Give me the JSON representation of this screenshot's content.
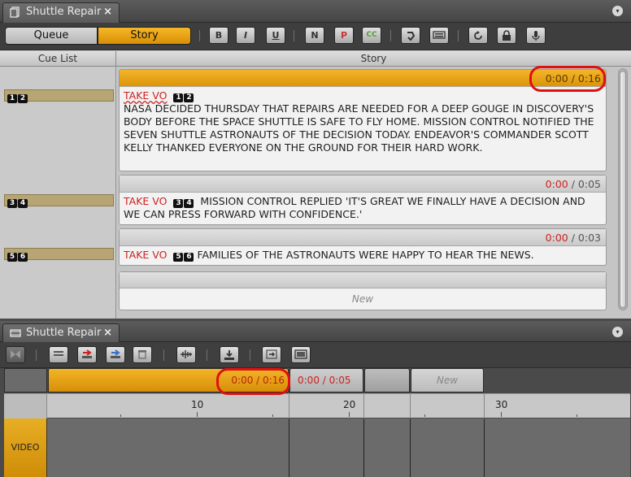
{
  "top_panel": {
    "tab_title": "Shuttle Repair",
    "close_glyph": "×",
    "menu_glyph": "▾",
    "modes": [
      "Queue",
      "Story"
    ],
    "active_mode": "Story",
    "format_buttons": [
      "B",
      "I",
      "U",
      "N",
      "P",
      "CC"
    ],
    "icons": [
      "spell-check-icon",
      "keyboard-icon",
      "refresh-icon",
      "lock-icon",
      "microphone-icon"
    ]
  },
  "columns": {
    "cue_list": "Cue List",
    "story": "Story"
  },
  "stories": [
    {
      "cue_numbers": [
        "1",
        "2"
      ],
      "time": "0:00 / 0:16",
      "take": "TAKE VO",
      "text": "NASA DECIDED THURSDAY THAT REPAIRS ARE NEEDED FOR A DEEP GOUGE IN DISCOVERY'S BODY BEFORE THE SPACE SHUTTLE IS SAFE TO FLY HOME. MISSION CONTROL NOTIFIED THE SEVEN SHUTTLE ASTRONAUTS OF THE DECISION TODAY. ENDEAVOR'S COMMANDER SCOTT KELLY THANKED EVERYONE ON THE GROUND FOR THEIR HARD WORK."
    },
    {
      "cue_numbers": [
        "3",
        "4"
      ],
      "time_elapsed": "0:00",
      "time_total": "/ 0:05",
      "take": "TAKE VO",
      "text": "MISSION CONTROL REPLIED 'IT'S GREAT WE FINALLY HAVE A DECISION AND WE CAN PRESS FORWARD WITH CONFIDENCE.'"
    },
    {
      "cue_numbers": [
        "5",
        "6"
      ],
      "time_elapsed": "0:00",
      "time_total": "/ 0:03",
      "take": "TAKE VO",
      "text": "FAMILIES OF THE ASTRONAUTS WERE HAPPY TO HEAR THE NEWS."
    }
  ],
  "new_story_label": "New",
  "bottom_panel": {
    "tab_title": "Shuttle Repair",
    "timeline_segments": [
      {
        "time": "0:00 / 0:16"
      },
      {
        "time": "0:00 / 0:05"
      },
      {
        "time": ""
      },
      {
        "time": "New"
      }
    ],
    "ruler_labels": [
      "10",
      "20",
      "30"
    ],
    "track_label": "VIDEO"
  },
  "colors": {
    "accent": "#e7a20f",
    "highlight_ring": "#e01010",
    "take_red": "#cc2222"
  }
}
